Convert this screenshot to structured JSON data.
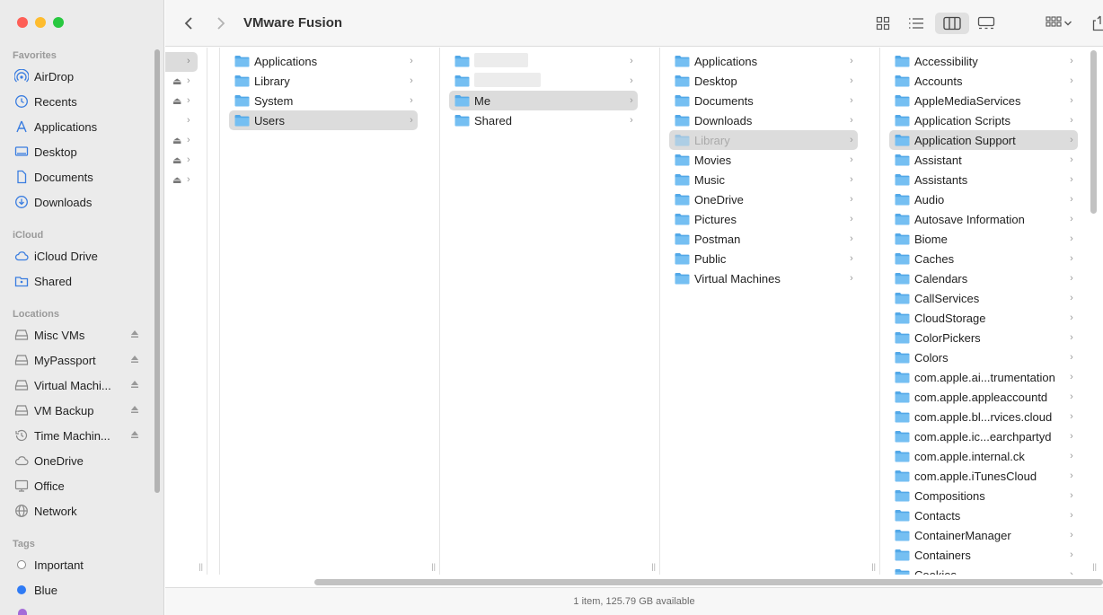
{
  "window": {
    "title": "VMware Fusion"
  },
  "sidebar": {
    "favorites_title": "Favorites",
    "favorites": [
      {
        "label": "AirDrop",
        "icon": "airdrop-icon"
      },
      {
        "label": "Recents",
        "icon": "clock-icon"
      },
      {
        "label": "Applications",
        "icon": "applications-icon"
      },
      {
        "label": "Desktop",
        "icon": "desktop-icon"
      },
      {
        "label": "Documents",
        "icon": "document-icon"
      },
      {
        "label": "Downloads",
        "icon": "download-icon"
      }
    ],
    "icloud_title": "iCloud",
    "icloud": [
      {
        "label": "iCloud Drive",
        "icon": "cloud-icon"
      },
      {
        "label": "Shared",
        "icon": "shared-folder-icon"
      }
    ],
    "locations_title": "Locations",
    "locations": [
      {
        "label": "Misc VMs",
        "icon": "drive-icon"
      },
      {
        "label": "MyPassport",
        "icon": "drive-icon"
      },
      {
        "label": "Virtual Machi...",
        "icon": "drive-icon"
      },
      {
        "label": "VM Backup",
        "icon": "drive-icon"
      },
      {
        "label": "Time Machin...",
        "icon": "time-machine-icon"
      },
      {
        "label": "OneDrive",
        "icon": "cloud-icon"
      },
      {
        "label": "Office",
        "icon": "computer-icon"
      },
      {
        "label": "Network",
        "icon": "globe-icon"
      }
    ],
    "tags_title": "Tags",
    "tags": [
      {
        "label": "Important",
        "color": "#ffffff"
      },
      {
        "label": "Blue",
        "color": "#2f7bf5"
      }
    ]
  },
  "columns": {
    "col2": [
      {
        "label": "Applications"
      },
      {
        "label": "Library"
      },
      {
        "label": "System"
      },
      {
        "label": "Users",
        "selected": true
      }
    ],
    "col3": [
      {
        "label": "",
        "redacted": true
      },
      {
        "label": "",
        "redacted": true
      },
      {
        "label": "Me",
        "selected": true
      },
      {
        "label": "Shared"
      }
    ],
    "col4": [
      {
        "label": "Applications"
      },
      {
        "label": "Desktop"
      },
      {
        "label": "Documents"
      },
      {
        "label": "Downloads"
      },
      {
        "label": "Library",
        "selected": true,
        "dim": true
      },
      {
        "label": "Movies"
      },
      {
        "label": "Music"
      },
      {
        "label": "OneDrive"
      },
      {
        "label": "Pictures"
      },
      {
        "label": "Postman"
      },
      {
        "label": "Public"
      },
      {
        "label": "Virtual Machines"
      }
    ],
    "col5": [
      {
        "label": "Accessibility"
      },
      {
        "label": "Accounts"
      },
      {
        "label": "AppleMediaServices"
      },
      {
        "label": "Application Scripts"
      },
      {
        "label": "Application Support",
        "selected": true
      },
      {
        "label": "Assistant"
      },
      {
        "label": "Assistants"
      },
      {
        "label": "Audio"
      },
      {
        "label": "Autosave Information"
      },
      {
        "label": "Biome"
      },
      {
        "label": "Caches"
      },
      {
        "label": "Calendars"
      },
      {
        "label": "CallServices"
      },
      {
        "label": "CloudStorage"
      },
      {
        "label": "ColorPickers"
      },
      {
        "label": "Colors"
      },
      {
        "label": "com.apple.ai...trumentation"
      },
      {
        "label": "com.apple.appleaccountd"
      },
      {
        "label": "com.apple.bl...rvices.cloud"
      },
      {
        "label": "com.apple.ic...earchpartyd"
      },
      {
        "label": "com.apple.internal.ck"
      },
      {
        "label": "com.apple.iTunesCloud"
      },
      {
        "label": "Compositions"
      },
      {
        "label": "Contacts"
      },
      {
        "label": "ContainerManager"
      },
      {
        "label": "Containers"
      },
      {
        "label": "Cookies"
      }
    ]
  },
  "status": {
    "text": "1 item, 125.79 GB available"
  }
}
